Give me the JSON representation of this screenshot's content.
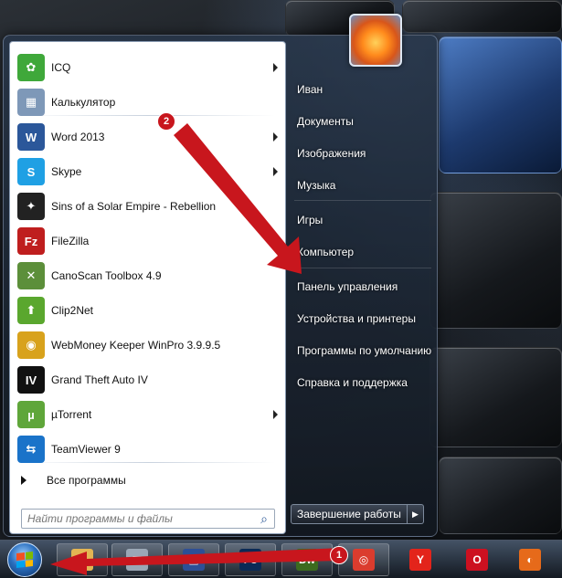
{
  "programs": [
    {
      "label": "ICQ",
      "icon": "icq-flower-icon",
      "color": "#3fa83a",
      "glyph": "✿",
      "submenu": true
    },
    {
      "label": "Калькулятор",
      "icon": "calculator-icon",
      "color": "#7e98b8",
      "glyph": "▦",
      "submenu": false
    },
    {
      "label": "Word 2013",
      "icon": "word-icon",
      "color": "#2b579a",
      "glyph": "W",
      "submenu": true
    },
    {
      "label": "Skype",
      "icon": "skype-icon",
      "color": "#1fa0e4",
      "glyph": "S",
      "submenu": true
    },
    {
      "label": "Sins of a Solar Empire - Rebellion",
      "icon": "game-icon",
      "color": "#222222",
      "glyph": "✦",
      "submenu": false
    },
    {
      "label": "FileZilla",
      "icon": "filezilla-icon",
      "color": "#bf1e1e",
      "glyph": "Fz",
      "submenu": false
    },
    {
      "label": "CanoScan Toolbox 4.9",
      "icon": "scanner-icon",
      "color": "#5c8f3a",
      "glyph": "✕",
      "submenu": false
    },
    {
      "label": "Clip2Net",
      "icon": "upload-arrow-icon",
      "color": "#5aa72e",
      "glyph": "⬆",
      "submenu": false
    },
    {
      "label": "WebMoney Keeper WinPro 3.9.9.5",
      "icon": "webmoney-icon",
      "color": "#d8a21c",
      "glyph": "◉",
      "submenu": false
    },
    {
      "label": "Grand Theft Auto IV",
      "icon": "gta-icon",
      "color": "#111111",
      "glyph": "IV",
      "submenu": false
    },
    {
      "label": "µTorrent",
      "icon": "utorrent-icon",
      "color": "#5fa63a",
      "glyph": "µ",
      "submenu": true
    },
    {
      "label": "TeamViewer 9",
      "icon": "teamviewer-icon",
      "color": "#1a73c9",
      "glyph": "⇆",
      "submenu": false
    }
  ],
  "all_programs_label": "Все программы",
  "search": {
    "placeholder": "Найти программы и файлы"
  },
  "right_items": [
    "Иван",
    "Документы",
    "Изображения",
    "Музыка",
    "Игры",
    "Компьютер",
    "Панель управления",
    "Устройства и принтеры",
    "Программы по умолчанию",
    "Справка и поддержка"
  ],
  "shutdown_label": "Завершение работы",
  "badges": {
    "first": "1",
    "second": "2"
  },
  "taskbar": [
    {
      "name": "explorer-taskbar-icon",
      "color": "#e3b553",
      "glyph": "▬"
    },
    {
      "name": "notepad-taskbar-icon",
      "color": "#9aa7b5",
      "glyph": "▤"
    },
    {
      "name": "floppy-taskbar-icon",
      "color": "#2d4f96",
      "glyph": "▣"
    },
    {
      "name": "photoshop-taskbar-icon",
      "color": "#0a2a56",
      "glyph": "Ps"
    },
    {
      "name": "dreamweaver-taskbar-icon",
      "color": "#3c6b1e",
      "glyph": "Dw"
    },
    {
      "name": "chrome-taskbar-icon",
      "color": "#db3c2e",
      "glyph": "◎"
    },
    {
      "name": "yandex-browser-taskbar-icon",
      "color": "#e3241b",
      "glyph": "Y"
    },
    {
      "name": "opera-taskbar-icon",
      "color": "#cc1020",
      "glyph": "O"
    },
    {
      "name": "firefox-taskbar-icon",
      "color": "#e66a1a",
      "glyph": "◐"
    }
  ],
  "colors": {
    "annotation_red": "#c8161d",
    "start_orb": "#2a6fbf"
  }
}
